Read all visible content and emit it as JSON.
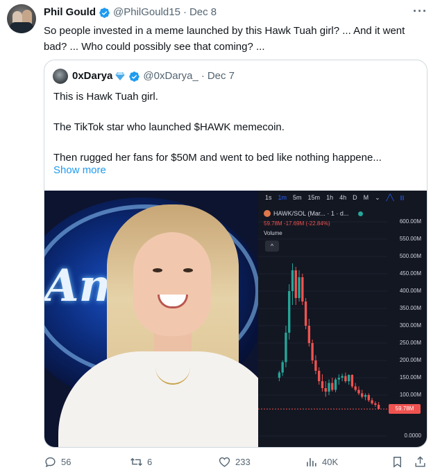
{
  "tweet": {
    "display_name": "Phil Gould",
    "handle": "@PhilGould15",
    "date": "Dec 8",
    "text": "So people invested in a meme launched by this Hawk Tuah girl? ... And it went bad? ... Who could possibly see that coming? ...",
    "more_icon": "more-icon"
  },
  "quote": {
    "display_name": "0xDarya",
    "handle": "@0xDarya_",
    "date": "Dec 7",
    "lines": [
      "This is Hawk Tuah girl.",
      "The TikTok star who launched $HAWK memecoin.",
      "Then rugged her fans for $50M and went to bed like nothing happene..."
    ],
    "show_more": "Show more"
  },
  "chart_overlay": {
    "timeframes": [
      "1s",
      "1m",
      "5m",
      "15m",
      "1h",
      "4h",
      "D",
      "M"
    ],
    "selected_timeframe": "1m",
    "dropdown": "⌄",
    "pair_label": "HAWK/SOL (Mar... · 1 · d...",
    "price_line": "59.78M -17.69M (-22.84%)",
    "volume_label": "Volume",
    "collapse_icon": "^",
    "last_price_tag": "59.78M"
  },
  "chart_data": {
    "type": "candlestick",
    "title": "HAWK/SOL (Mar... · 1 · d...",
    "ylabel": "",
    "yticks": [
      "600.00M",
      "550.00M",
      "500.00M",
      "450.00M",
      "400.00M",
      "350.00M",
      "300.00M",
      "250.00M",
      "200.00M",
      "150.00M",
      "100.00M",
      "0.0000"
    ],
    "ylim": [
      40,
      610
    ],
    "last_price": 59.78,
    "candles": [
      {
        "o": 150,
        "h": 170,
        "l": 140,
        "c": 165
      },
      {
        "o": 165,
        "h": 200,
        "l": 155,
        "c": 195
      },
      {
        "o": 195,
        "h": 300,
        "l": 180,
        "c": 280
      },
      {
        "o": 280,
        "h": 420,
        "l": 260,
        "c": 400
      },
      {
        "o": 400,
        "h": 480,
        "l": 360,
        "c": 460
      },
      {
        "o": 460,
        "h": 470,
        "l": 360,
        "c": 380
      },
      {
        "o": 380,
        "h": 460,
        "l": 370,
        "c": 440
      },
      {
        "o": 440,
        "h": 450,
        "l": 360,
        "c": 370
      },
      {
        "o": 370,
        "h": 380,
        "l": 290,
        "c": 300
      },
      {
        "o": 300,
        "h": 320,
        "l": 240,
        "c": 250
      },
      {
        "o": 250,
        "h": 260,
        "l": 190,
        "c": 200
      },
      {
        "o": 200,
        "h": 215,
        "l": 160,
        "c": 170
      },
      {
        "o": 170,
        "h": 180,
        "l": 130,
        "c": 140
      },
      {
        "o": 140,
        "h": 160,
        "l": 110,
        "c": 120
      },
      {
        "o": 120,
        "h": 140,
        "l": 95,
        "c": 110
      },
      {
        "o": 110,
        "h": 145,
        "l": 100,
        "c": 135
      },
      {
        "o": 135,
        "h": 150,
        "l": 110,
        "c": 115
      },
      {
        "o": 115,
        "h": 150,
        "l": 108,
        "c": 145
      },
      {
        "o": 145,
        "h": 160,
        "l": 130,
        "c": 150
      },
      {
        "o": 150,
        "h": 162,
        "l": 140,
        "c": 155
      },
      {
        "o": 155,
        "h": 165,
        "l": 135,
        "c": 140
      },
      {
        "o": 140,
        "h": 160,
        "l": 130,
        "c": 158
      },
      {
        "o": 158,
        "h": 160,
        "l": 120,
        "c": 125
      },
      {
        "o": 125,
        "h": 135,
        "l": 110,
        "c": 115
      },
      {
        "o": 115,
        "h": 125,
        "l": 100,
        "c": 105
      },
      {
        "o": 105,
        "h": 115,
        "l": 90,
        "c": 95
      },
      {
        "o": 95,
        "h": 105,
        "l": 85,
        "c": 100
      },
      {
        "o": 100,
        "h": 105,
        "l": 80,
        "c": 85
      },
      {
        "o": 85,
        "h": 92,
        "l": 72,
        "c": 76
      },
      {
        "o": 76,
        "h": 82,
        "l": 66,
        "c": 72
      },
      {
        "o": 72,
        "h": 80,
        "l": 58,
        "c": 60
      }
    ]
  },
  "actions": {
    "replies": "56",
    "reposts": "6",
    "likes": "233",
    "views": "40K"
  },
  "colors": {
    "accent": "#1d9bf0",
    "up": "#26a69a",
    "down": "#ef5350",
    "chart_bg": "#131722"
  }
}
